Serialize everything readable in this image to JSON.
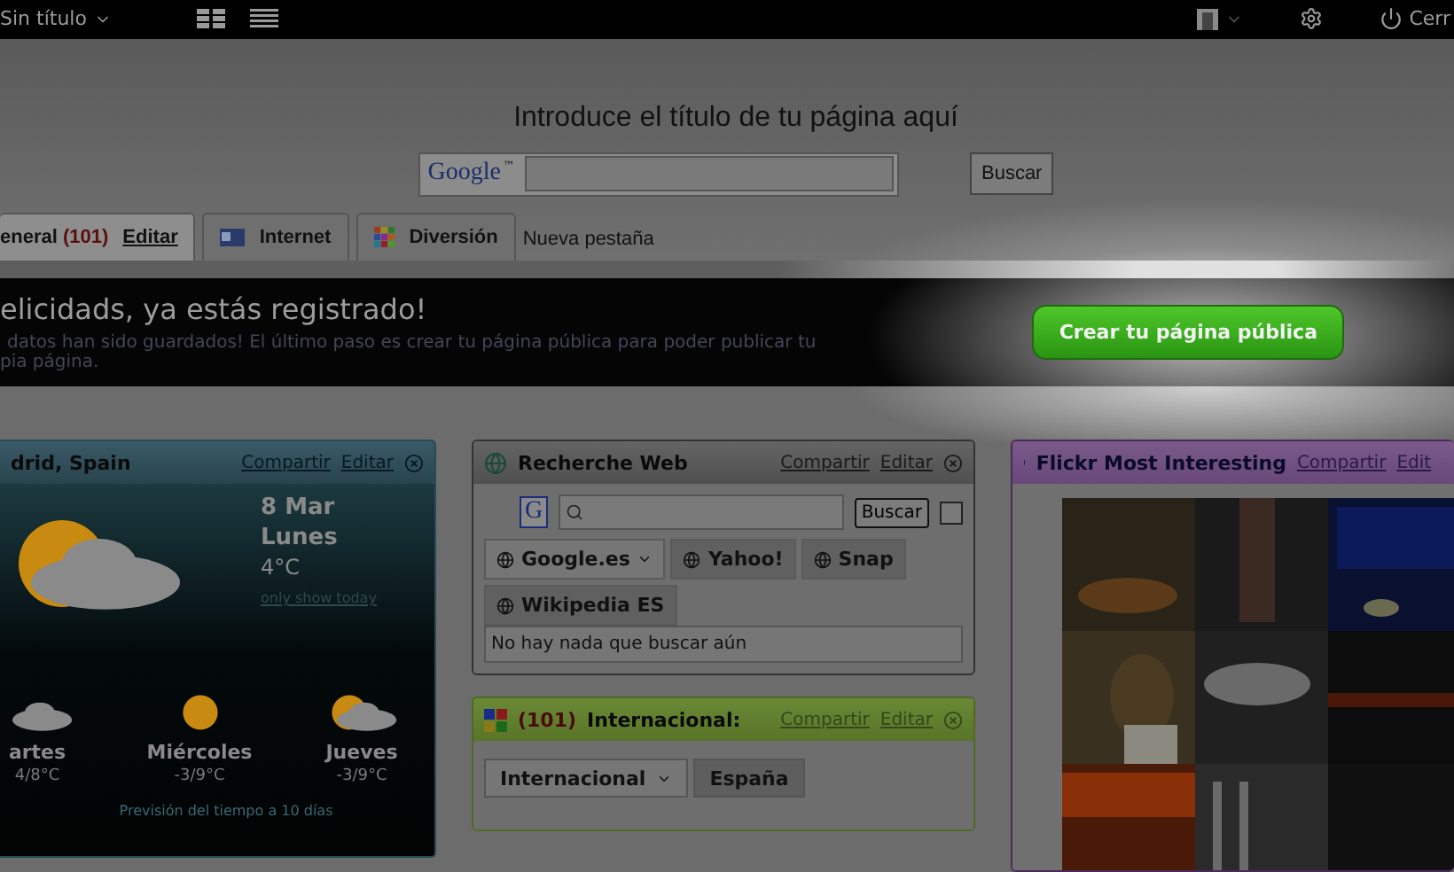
{
  "topbar": {
    "page_title": "Sin título",
    "logout": "Cerr"
  },
  "header": {
    "title": "Introduce el título de tu página aquí",
    "search": {
      "logo": "Google",
      "tm": "™",
      "button": "Buscar"
    }
  },
  "tabs": [
    {
      "kind": "tab",
      "label": "eneral",
      "count": "(101)",
      "edit": "Editar",
      "selected": true
    },
    {
      "kind": "tab",
      "label": "Internet",
      "selected": false
    },
    {
      "kind": "tab",
      "label": "Diversión",
      "selected": false
    },
    {
      "kind": "new",
      "label": "Nueva pestaña"
    }
  ],
  "banner": {
    "title": "elicidads, ya estás registrado!",
    "lines": [
      "datos han sido guardados! El último paso es crear tu página pública para poder publicar tu",
      "pia página."
    ],
    "button": "Crear tu página pública"
  },
  "weather": {
    "title": "drid, Spain",
    "share": "Compartir",
    "edit": "Editar",
    "date": "8 Mar",
    "day": "Lunes",
    "temp": "4°C",
    "link": "only show today",
    "forecast": [
      {
        "day": "artes",
        "temp": "4/8°C",
        "kind": "cloudy"
      },
      {
        "day": "Miércoles",
        "temp": "-3/9°C",
        "kind": "sunny"
      },
      {
        "day": "Jueves",
        "temp": "-3/9°C",
        "kind": "partly"
      }
    ],
    "footer": "Previsión del tiempo a 10 días"
  },
  "websearch": {
    "title": "Recherche Web",
    "google_icon": "G",
    "share": "Compartir",
    "edit": "Editar",
    "button": "Buscar",
    "checked": false,
    "engines": [
      {
        "label": "Google.es",
        "selected": true
      },
      {
        "label": "Yahoo!",
        "selected": false
      },
      {
        "label": "Snap",
        "selected": false
      },
      {
        "label": "Wikipedia ES",
        "selected": false
      }
    ],
    "result": "No hay nada que buscar aún"
  },
  "news": {
    "count": "(101)",
    "title": "Internacional:",
    "share": "Compartir",
    "edit": "Editar",
    "tabs": [
      {
        "label": "Internacional",
        "selected": true
      },
      {
        "label": "España",
        "selected": false
      }
    ]
  },
  "flickr": {
    "title": "Flickr Most Interesting",
    "share": "Compartir",
    "edit": "Edit"
  }
}
